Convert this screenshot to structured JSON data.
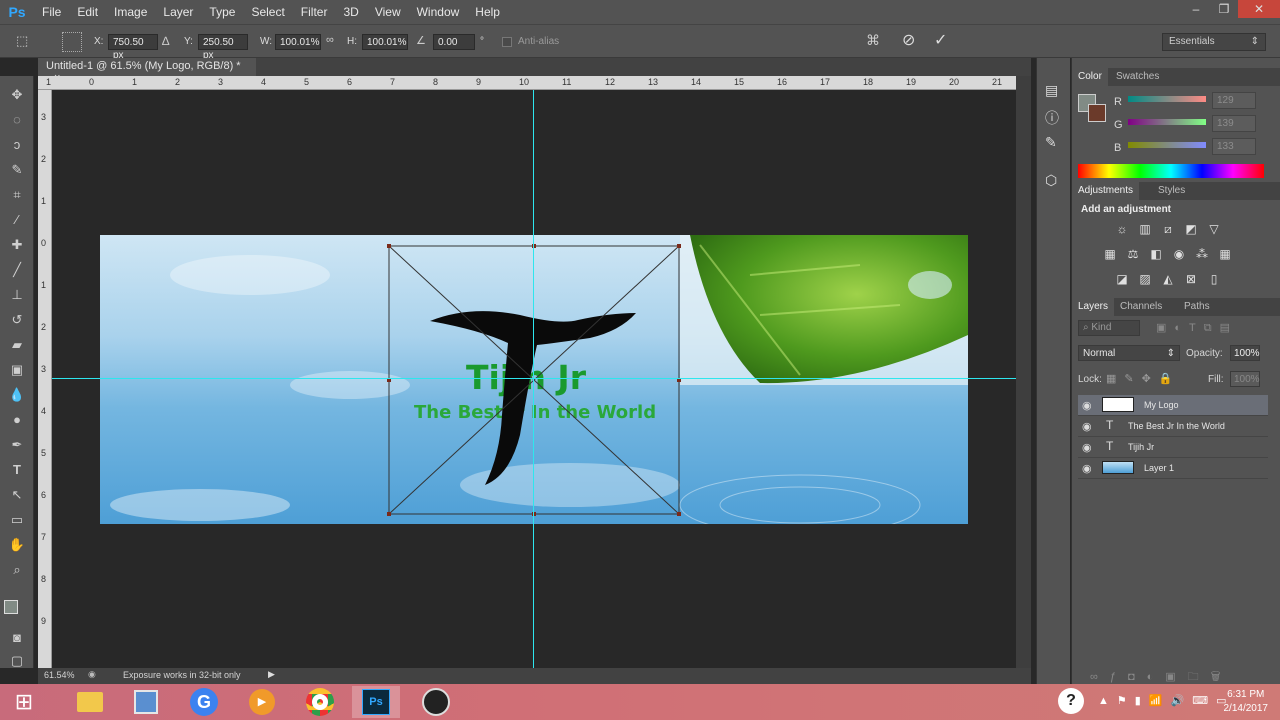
{
  "app": {
    "logo": "Ps"
  },
  "menu": [
    "File",
    "Edit",
    "Image",
    "Layer",
    "Type",
    "Select",
    "Filter",
    "3D",
    "View",
    "Window",
    "Help"
  ],
  "window_controls": [
    "–",
    "❐",
    "✕"
  ],
  "options": {
    "x_label": "X:",
    "x_value": "750.50 px",
    "y_label": "Y:",
    "y_value": "250.50 px",
    "w_label": "W:",
    "w_value": "100.01%",
    "h_label": "H:",
    "h_value": "100.01%",
    "angle_value": "0.00",
    "angle_unit": "°",
    "antialias_label": "Anti-alias",
    "workspace": "Essentials"
  },
  "document": {
    "tab_title": "Untitled-1 @ 61.5% (My Logo, RGB/8) *",
    "tab_close": "×"
  },
  "ruler_h": [
    "1",
    "0",
    "1",
    "2",
    "3",
    "4",
    "5",
    "6",
    "7",
    "8",
    "9",
    "10",
    "11",
    "12",
    "13",
    "14",
    "15",
    "16",
    "17",
    "18",
    "19",
    "20",
    "21"
  ],
  "ruler_v": [
    "3",
    "2",
    "1",
    "0",
    "1",
    "2",
    "3",
    "4",
    "5",
    "6",
    "7",
    "8",
    "9"
  ],
  "canvas_text": {
    "title": "Tijih Jr",
    "subtitle": "The Best Jr In the World"
  },
  "status": {
    "zoom": "61.54%",
    "message": "Exposure works in 32-bit only"
  },
  "color_panel": {
    "tabs": [
      "Color",
      "Swatches"
    ],
    "channels": [
      {
        "label": "R",
        "value": "129"
      },
      {
        "label": "G",
        "value": "139"
      },
      {
        "label": "B",
        "value": "133"
      }
    ],
    "foreground": "#818b85",
    "background": "#6b3a2a"
  },
  "adjustments": {
    "tabs": [
      "Adjustments",
      "Styles"
    ],
    "heading": "Add an adjustment"
  },
  "layers_panel": {
    "tabs": [
      "Layers",
      "Channels",
      "Paths"
    ],
    "filter_kind": "Kind",
    "blend_mode": "Normal",
    "opacity_label": "Opacity:",
    "opacity_value": "100%",
    "lock_label": "Lock:",
    "fill_label": "Fill:",
    "fill_value": "100%",
    "layers": [
      {
        "name": "My Logo",
        "type": "image",
        "selected": true
      },
      {
        "name": "The Best Jr In the World",
        "type": "text",
        "selected": false
      },
      {
        "name": "Tijih Jr",
        "type": "text",
        "selected": false
      },
      {
        "name": "Layer 1",
        "type": "image",
        "selected": false
      }
    ]
  },
  "taskbar": {
    "time": "6:31 PM",
    "date": "2/14/2017",
    "active_app": "Ps"
  },
  "colors": {
    "ui_dark": "#535353",
    "guide": "#2ee6ee",
    "title_green": "#1a9a2e",
    "accent": "#31a8ff"
  }
}
